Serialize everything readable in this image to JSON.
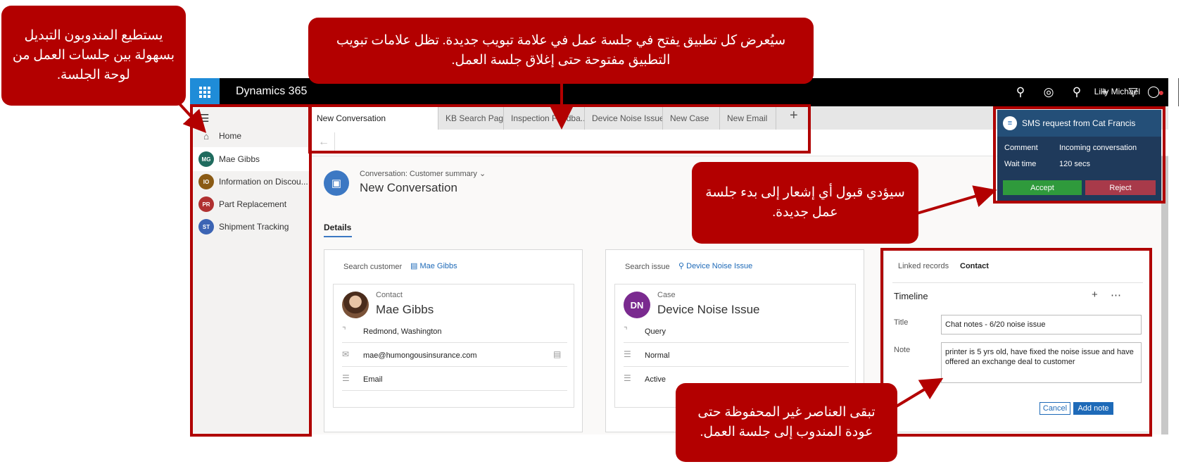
{
  "app": {
    "brand": "Dynamics 365",
    "top_icons": [
      "search-icon",
      "target-icon",
      "lightbulb-icon",
      "plus-icon",
      "filter-icon",
      "presence-dot-icon"
    ],
    "settings_icon": "gear-icon",
    "help_label": "?",
    "user_name": "Lilly Michael",
    "user_icon": "person-icon"
  },
  "sidebar": {
    "home_label": "Home",
    "sessions": [
      {
        "initials": "MG",
        "label": "Mae Gibbs",
        "color": "#1f6b5e"
      },
      {
        "initials": "IO",
        "label": "Information on Discou...",
        "color": "#8a5a14"
      },
      {
        "initials": "PR",
        "label": "Part Replacement",
        "color": "#b03030"
      },
      {
        "initials": "ST",
        "label": "Shipment Tracking",
        "color": "#3c64b4"
      }
    ]
  },
  "tabs": [
    {
      "label": "New Conversation"
    },
    {
      "label": "KB Search Page"
    },
    {
      "label": "Inspection Feedba..."
    },
    {
      "label": "Device Noise Issue"
    },
    {
      "label": "New Case"
    },
    {
      "label": "New Email"
    }
  ],
  "conversation": {
    "subtitle": "Conversation: Customer summary",
    "title": "New Conversation",
    "details_tab": "Details"
  },
  "customer_card": {
    "search_label": "Search customer",
    "search_value": "Mae Gibbs",
    "type_label": "Contact",
    "name": "Mae Gibbs",
    "location": "Redmond, Washington",
    "email": "mae@humongousinsurance.com",
    "channel": "Email"
  },
  "issue_card": {
    "search_label": "Search issue",
    "search_value": "Device Noise Issue",
    "badge": "DN",
    "type_label": "Case",
    "name": "Device Noise Issue",
    "type": "Query",
    "priority": "Normal",
    "status": "Active"
  },
  "linked": {
    "tab1": "Linked records",
    "tab2": "Contact",
    "timeline": "Timeline",
    "title_label": "Title",
    "title_value": "Chat notes - 6/20 noise issue",
    "note_label": "Note",
    "note_value": "printer is 5 yrs old, have fixed the noise issue and have offered an exchange deal to customer",
    "cancel": "Cancel",
    "add_note": "Add note"
  },
  "notification": {
    "title": "SMS request from Cat Francis",
    "comment_label": "Comment",
    "comment_value": "Incoming conversation",
    "wait_label": "Wait time",
    "wait_value": "120 secs",
    "accept": "Accept",
    "reject": "Reject"
  },
  "callouts": {
    "sessions": "يستطيع المندوبون التبديل بسهولة بين جلسات العمل من لوحة الجلسة.",
    "tabs": "سيُعرض كل تطبيق يفتح في جلسة عمل في علامة تبويب جديدة.  تظل علامات تبويب التطبيق مفتوحة حتى إغلاق جلسة العمل.",
    "notification": "سيؤدي قبول أي إشعار إلى بدء جلسة عمل جديدة.",
    "unsaved": "تبقى العناصر غير المحفوظة حتى عودة المندوب إلى جلسة العمل."
  },
  "colors": {
    "callout": "#b30000",
    "accent": "#1e6ab8",
    "accept": "#2f9a3c",
    "reject": "#a83a4a"
  }
}
